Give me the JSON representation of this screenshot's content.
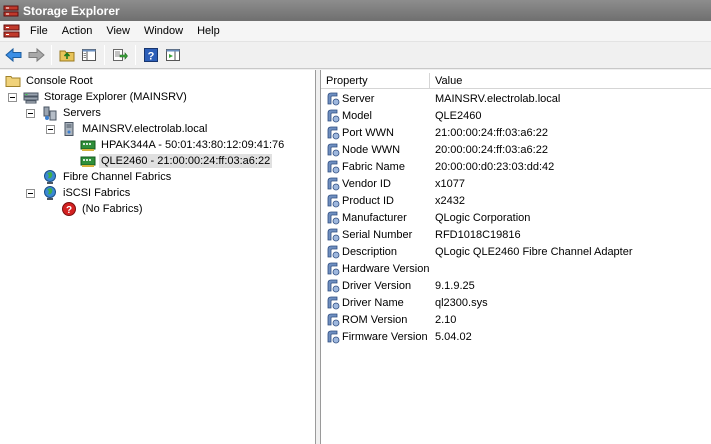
{
  "window": {
    "title": "Storage Explorer"
  },
  "menu": [
    "File",
    "Action",
    "View",
    "Window",
    "Help"
  ],
  "toolbar": [
    "back-icon",
    "forward-icon",
    "up-folder-icon",
    "show-hide-tree-icon",
    "export-list-icon",
    "help-icon",
    "action-pane-icon"
  ],
  "tree": {
    "console_root": "Console Root",
    "storage_explorer": "Storage Explorer (MAINSRV)",
    "servers": "Servers",
    "server": "MAINSRV.electrolab.local",
    "hba1": "HPAK344A - 50:01:43:80:12:09:41:76",
    "hba2": "QLE2460 - 21:00:00:24:ff:03:a6:22",
    "fc_fabrics": "Fibre Channel Fabrics",
    "iscsi_fabrics": "iSCSI Fabrics",
    "no_fabrics": "(No Fabrics)"
  },
  "list": {
    "col_property": "Property",
    "col_value": "Value",
    "rows": [
      {
        "property": "Server",
        "value": "MAINSRV.electrolab.local"
      },
      {
        "property": "Model",
        "value": "QLE2460"
      },
      {
        "property": "Port WWN",
        "value": "21:00:00:24:ff:03:a6:22"
      },
      {
        "property": "Node WWN",
        "value": "20:00:00:24:ff:03:a6:22"
      },
      {
        "property": "Fabric Name",
        "value": "20:00:00:d0:23:03:dd:42"
      },
      {
        "property": "Vendor ID",
        "value": "x1077"
      },
      {
        "property": "Product ID",
        "value": "x2432"
      },
      {
        "property": "Manufacturer",
        "value": "QLogic Corporation"
      },
      {
        "property": "Serial Number",
        "value": "RFD1018C19816"
      },
      {
        "property": "Description",
        "value": "QLogic QLE2460 Fibre Channel Adapter"
      },
      {
        "property": "Hardware Version",
        "value": ""
      },
      {
        "property": "Driver Version",
        "value": "9.1.9.25"
      },
      {
        "property": "Driver Name",
        "value": "ql2300.sys"
      },
      {
        "property": "ROM Version",
        "value": "2.10"
      },
      {
        "property": "Firmware Version",
        "value": "5.04.02"
      }
    ]
  }
}
